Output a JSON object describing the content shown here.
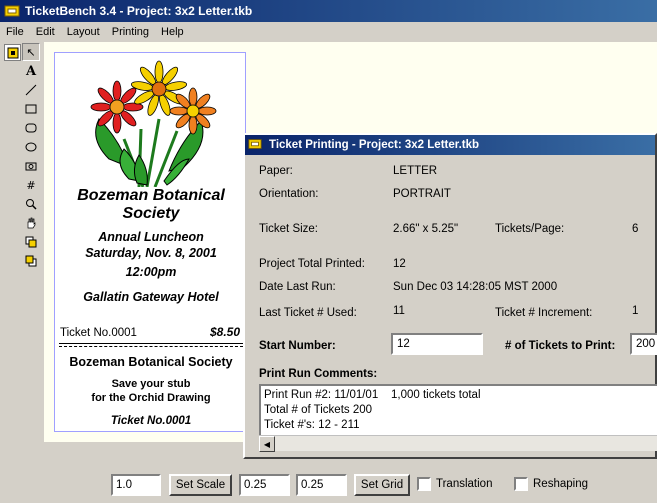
{
  "window": {
    "title": "TicketBench 3.4 - Project: 3x2 Letter.tkb"
  },
  "menu": [
    "File",
    "Edit",
    "Layout",
    "Printing",
    "Help"
  ],
  "toolbar": {
    "tools": [
      {
        "name": "pointer-icon",
        "glyph": "↖"
      },
      {
        "name": "text-icon",
        "glyph": "A"
      },
      {
        "name": "line-icon",
        "glyph": "╲"
      },
      {
        "name": "rectangle-icon",
        "glyph": "▭"
      },
      {
        "name": "rounded-rectangle-icon",
        "glyph": "▢"
      },
      {
        "name": "ellipse-icon",
        "glyph": "⬭"
      },
      {
        "name": "camera-icon",
        "glyph": "◙"
      },
      {
        "name": "number-icon",
        "glyph": "#"
      },
      {
        "name": "zoom-icon",
        "glyph": "⚲"
      },
      {
        "name": "hand-icon",
        "glyph": "✋"
      },
      {
        "name": "bring-front-icon",
        "glyph": "⧉"
      },
      {
        "name": "send-back-icon",
        "glyph": "⧉"
      }
    ]
  },
  "ticket": {
    "org": "Bozeman Botanical Society",
    "event_line1": "Annual Luncheon",
    "event_line2": "Saturday, Nov. 8, 2001",
    "time": "12:00pm",
    "venue": "Gallatin Gateway Hotel",
    "number": "Ticket No.0001",
    "price": "$8.50",
    "stub_org": "Bozeman Botanical Society",
    "stub_msg1": "Save your stub",
    "stub_msg2": "for the Orchid Drawing",
    "stub_number": "Ticket No.0001"
  },
  "dialog": {
    "title": "Ticket Printing - Project: 3x2 Letter.tkb",
    "paper_label": "Paper:",
    "paper": "LETTER",
    "orientation_label": "Orientation:",
    "orientation": "PORTRAIT",
    "size_label": "Ticket Size:",
    "size": "2.66\" x 5.25\"",
    "per_page_label": "Tickets/Page:",
    "per_page": "6",
    "total_label": "Project Total Printed:",
    "total": "12",
    "last_run_label": "Date Last Run:",
    "last_run": "Sun Dec 03 14:28:05 MST 2000",
    "last_used_label": "Last Ticket # Used:",
    "last_used": "11",
    "increment_label": "Ticket # Increment:",
    "increment": "1",
    "start_label": "Start Number:",
    "start_value": "12",
    "count_label": "# of Tickets to Print:",
    "count_value": "200",
    "comments_label": "Print Run Comments:",
    "comments": [
      "Print Run #2: 11/01/01    1,000 tickets total",
      "Total # of Tickets 200",
      "Ticket #'s: 12 - 211"
    ]
  },
  "bottom": {
    "scale_value": "1.0",
    "set_scale": "Set Scale",
    "grid_x": "0.25",
    "grid_y": "0.25",
    "set_grid": "Set Grid",
    "translation": "Translation",
    "reshaping": "Reshaping"
  },
  "colors": {
    "titlebar": "#0a246a",
    "canvas": "#fffff0",
    "ticket_border": "#a0a0ff"
  }
}
